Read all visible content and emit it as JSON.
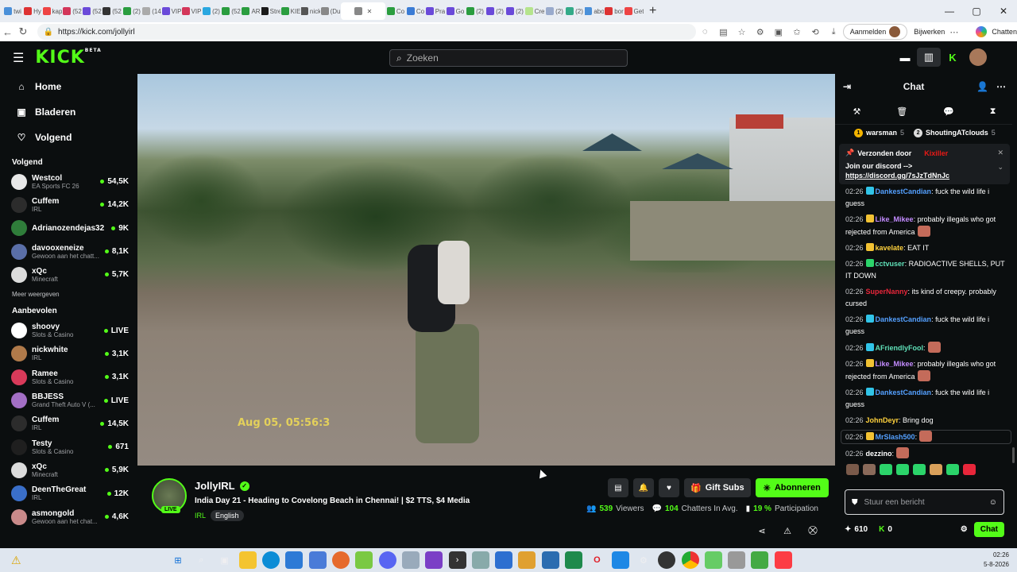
{
  "browser": {
    "tabs": [
      "twi",
      "Hy",
      "kap",
      "(52",
      "(52",
      "(52",
      "(2)",
      "(14",
      "VIP",
      "VIP",
      "(2)",
      "(52",
      "AR",
      "Stre",
      "KIE",
      "nick",
      "(Du",
      "",
      "Co",
      "Co",
      "Pra",
      "Go",
      "(2)",
      "(2)",
      "(2)",
      "Cre",
      "(2)",
      "(2)",
      "abo",
      "bor",
      "Get"
    ],
    "active_tab_index": 17,
    "url": "https://kick.com/jollyirl",
    "signin_label": "Aanmelden",
    "update_label": "Bijwerken",
    "copilot_label": "Chatten"
  },
  "header": {
    "logo": "KICK",
    "logo_sup": "BETA",
    "search_placeholder": "Zoeken"
  },
  "sidebar": {
    "nav": [
      {
        "label": "Home",
        "icon": "home-icon"
      },
      {
        "label": "Bladeren",
        "icon": "browse-icon"
      },
      {
        "label": "Volgend",
        "icon": "heart-icon"
      }
    ],
    "following_title": "Volgend",
    "following": [
      {
        "name": "Westcol",
        "category": "EA Sports FC 26",
        "viewers": "54,5K",
        "color": "#e8e8e8"
      },
      {
        "name": "Cuffem",
        "category": "IRL",
        "viewers": "14,2K",
        "color": "#2c2c2c"
      },
      {
        "name": "Adrianozendejas32",
        "category": "",
        "viewers": "9K",
        "color": "#2f7d3a"
      },
      {
        "name": "davooxeneize",
        "category": "Gewoon aan het chatt...",
        "viewers": "8,1K",
        "color": "#5a6fa8"
      },
      {
        "name": "xQc",
        "category": "Minecraft",
        "viewers": "5,7K",
        "color": "#dcdcdc"
      }
    ],
    "show_more": "Meer weergeven",
    "recommended_title": "Aanbevolen",
    "recommended": [
      {
        "name": "shoovy",
        "category": "Slots & Casino",
        "viewers": "LIVE",
        "color": "#ffffff"
      },
      {
        "name": "nickwhite",
        "category": "IRL",
        "viewers": "3,1K",
        "color": "#b07a4a"
      },
      {
        "name": "Ramee",
        "category": "Slots & Casino",
        "viewers": "3,1K",
        "color": "#d93a5a"
      },
      {
        "name": "BBJESS",
        "category": "Grand Theft Auto V (...",
        "viewers": "LIVE",
        "color": "#a36fc5"
      },
      {
        "name": "Cuffem",
        "category": "IRL",
        "viewers": "14,5K",
        "color": "#2c2c2c"
      },
      {
        "name": "Testy",
        "category": "Slots & Casino",
        "viewers": "671",
        "color": "#1f1f1f"
      },
      {
        "name": "xQc",
        "category": "Minecraft",
        "viewers": "5,9K",
        "color": "#dcdcdc"
      },
      {
        "name": "DeenTheGreat",
        "category": "IRL",
        "viewers": "12K",
        "color": "#3a6fc9"
      },
      {
        "name": "asmongold",
        "category": "Gewoon aan het chat...",
        "viewers": "4,6K",
        "color": "#c98a8a"
      }
    ]
  },
  "video": {
    "timestamp_overlay": "Aug 05, 05:56:3"
  },
  "stream": {
    "streamer": "JollyIRL",
    "live_badge": "LIVE",
    "title": "India Day 21 - Heading to Covelong Beach in Chennai! | $2 TTS, $4 Media",
    "category": "IRL",
    "language": "English",
    "gift_label": "Gift Subs",
    "subscribe_label": "Abonneren",
    "viewers_count": "539",
    "viewers_label": "Viewers",
    "chatters_count": "104",
    "chatters_label": "Chatters In Avg.",
    "participation_count": "19 %",
    "participation_label": "Participation"
  },
  "chat": {
    "title": "Chat",
    "gifters": [
      {
        "name": "warsman",
        "count": "5"
      },
      {
        "name": "ShoutingATclouds",
        "count": "5"
      }
    ],
    "pinned_by_label": "Verzonden door",
    "pinned_by_user": "Kixiller",
    "pinned_msg": "Join our discord -->",
    "pinned_link": "https://discord.gg/7sJzTdNnJc",
    "messages": [
      {
        "time": "02:26",
        "user": "DankestCandian",
        "color": "#54a0ff",
        "badge": "#31c4e8",
        "text": ": fuck the wild life i guess",
        "emote": false,
        "hl": false
      },
      {
        "time": "02:26",
        "user": "Like_Mikee",
        "color": "#c38bff",
        "badge": "#f2c233",
        "text": ": probably illegals who got rejected from America",
        "emote": true,
        "hl": false
      },
      {
        "time": "02:26",
        "user": "kavelate",
        "color": "#ffd23d",
        "badge": "#f2c233",
        "text": ": EAT IT",
        "emote": false,
        "hl": false
      },
      {
        "time": "02:26",
        "user": "cctvuser",
        "color": "#5fe0b8",
        "badge": "#2bd46a",
        "text": ": RADIOACTIVE SHELLS, PUT IT DOWN",
        "emote": false,
        "hl": false
      },
      {
        "time": "02:26",
        "user": "SuperNanny",
        "color": "#e8263a",
        "badge": "",
        "text": ": its kind of creepy. probably cursed",
        "emote": false,
        "hl": false
      },
      {
        "time": "02:26",
        "user": "DankestCandian",
        "color": "#54a0ff",
        "badge": "#31c4e8",
        "text": ": fuck the wild life i guess",
        "emote": false,
        "hl": false
      },
      {
        "time": "02:26",
        "user": "AFriendlyFool",
        "color": "#5fe0b8",
        "badge": "#31c4e8",
        "text": ":",
        "emote": true,
        "hl": false
      },
      {
        "time": "02:26",
        "user": "Like_Mikee",
        "color": "#c38bff",
        "badge": "#f2c233",
        "text": ": probably illegals who got rejected from America",
        "emote": true,
        "hl": false
      },
      {
        "time": "02:26",
        "user": "DankestCandian",
        "color": "#54a0ff",
        "badge": "#31c4e8",
        "text": ": fuck the wild life i guess",
        "emote": false,
        "hl": false
      },
      {
        "time": "02:26",
        "user": "JohnDeyr",
        "color": "#ffd23d",
        "badge": "",
        "text": ": Bring dog",
        "emote": false,
        "hl": false
      },
      {
        "time": "02:26",
        "user": "MrSlash500",
        "color": "#54a0ff",
        "badge": "#f2c233",
        "text": ":",
        "emote": true,
        "hl": true
      },
      {
        "time": "02:26",
        "user": "dezzino",
        "color": "#ffffff",
        "badge": "",
        "text": ":",
        "emote": true,
        "hl": false
      }
    ],
    "input_placeholder": "Stuur een bericht",
    "points": "610",
    "kicks": "0",
    "send_label": "Chat"
  },
  "taskbar": {
    "time": "02:26",
    "date": "5-8-2026"
  }
}
